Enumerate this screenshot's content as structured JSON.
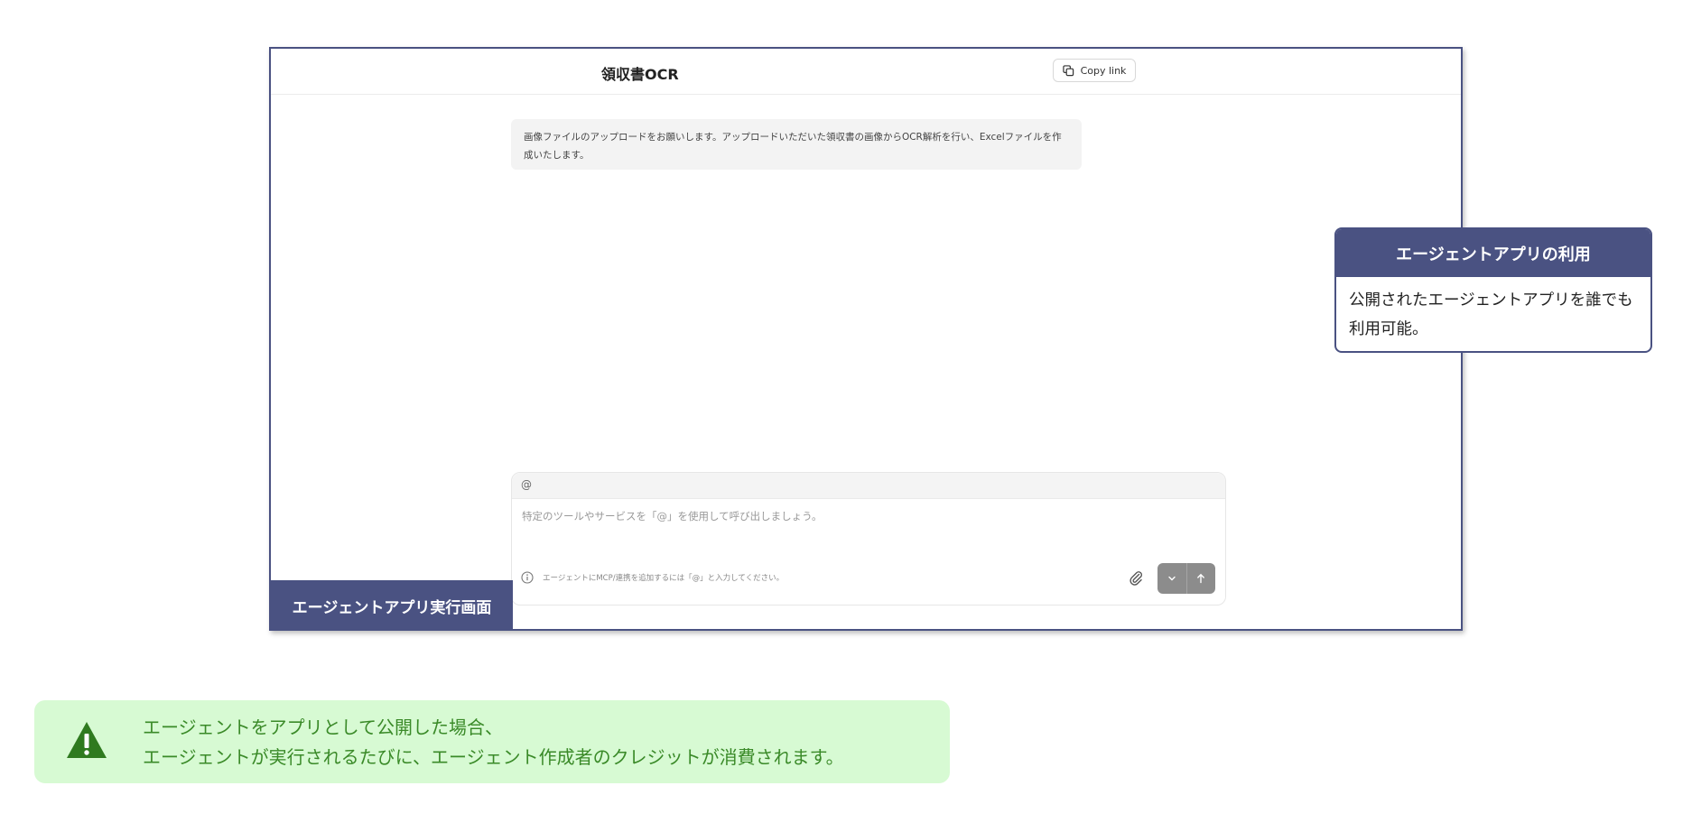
{
  "app": {
    "title": "領収書OCR",
    "copy_link_label": "Copy link"
  },
  "chat": {
    "assistant_message": "画像ファイルのアップロードをお願いします。アップロードいただいた領収書の画像からOCR解析を行い、Excelファイルを作成いたします。",
    "mention_symbol": "@",
    "input_placeholder": "特定のツールやサービスを「@」を使用して呼び出しましょう。",
    "input_value": "",
    "hint": "エージェントにMCP/連携を追加するには「@」と入力してください。"
  },
  "frame_caption": "エージェントアプリ実行画面",
  "callout": {
    "title": "エージェントアプリの利用",
    "body": "公開されたエージェントアプリを誰でも利用可能。"
  },
  "note": {
    "line1": "エージェントをアプリとして公開した場合、",
    "line2": "エージェントが実行されるたびに、エージェント作成者のクレジットが消費されます。"
  },
  "icons": {
    "copy": "copy-icon",
    "info": "info-icon",
    "attach": "paperclip-icon",
    "dropdown": "chevron-down-icon",
    "send": "arrow-up-icon",
    "warning": "warning-icon"
  },
  "colors": {
    "accent": "#4a5282",
    "note_background": "#d7fad3",
    "note_text": "#3a8a28",
    "send_button": "#8c8c8c"
  }
}
